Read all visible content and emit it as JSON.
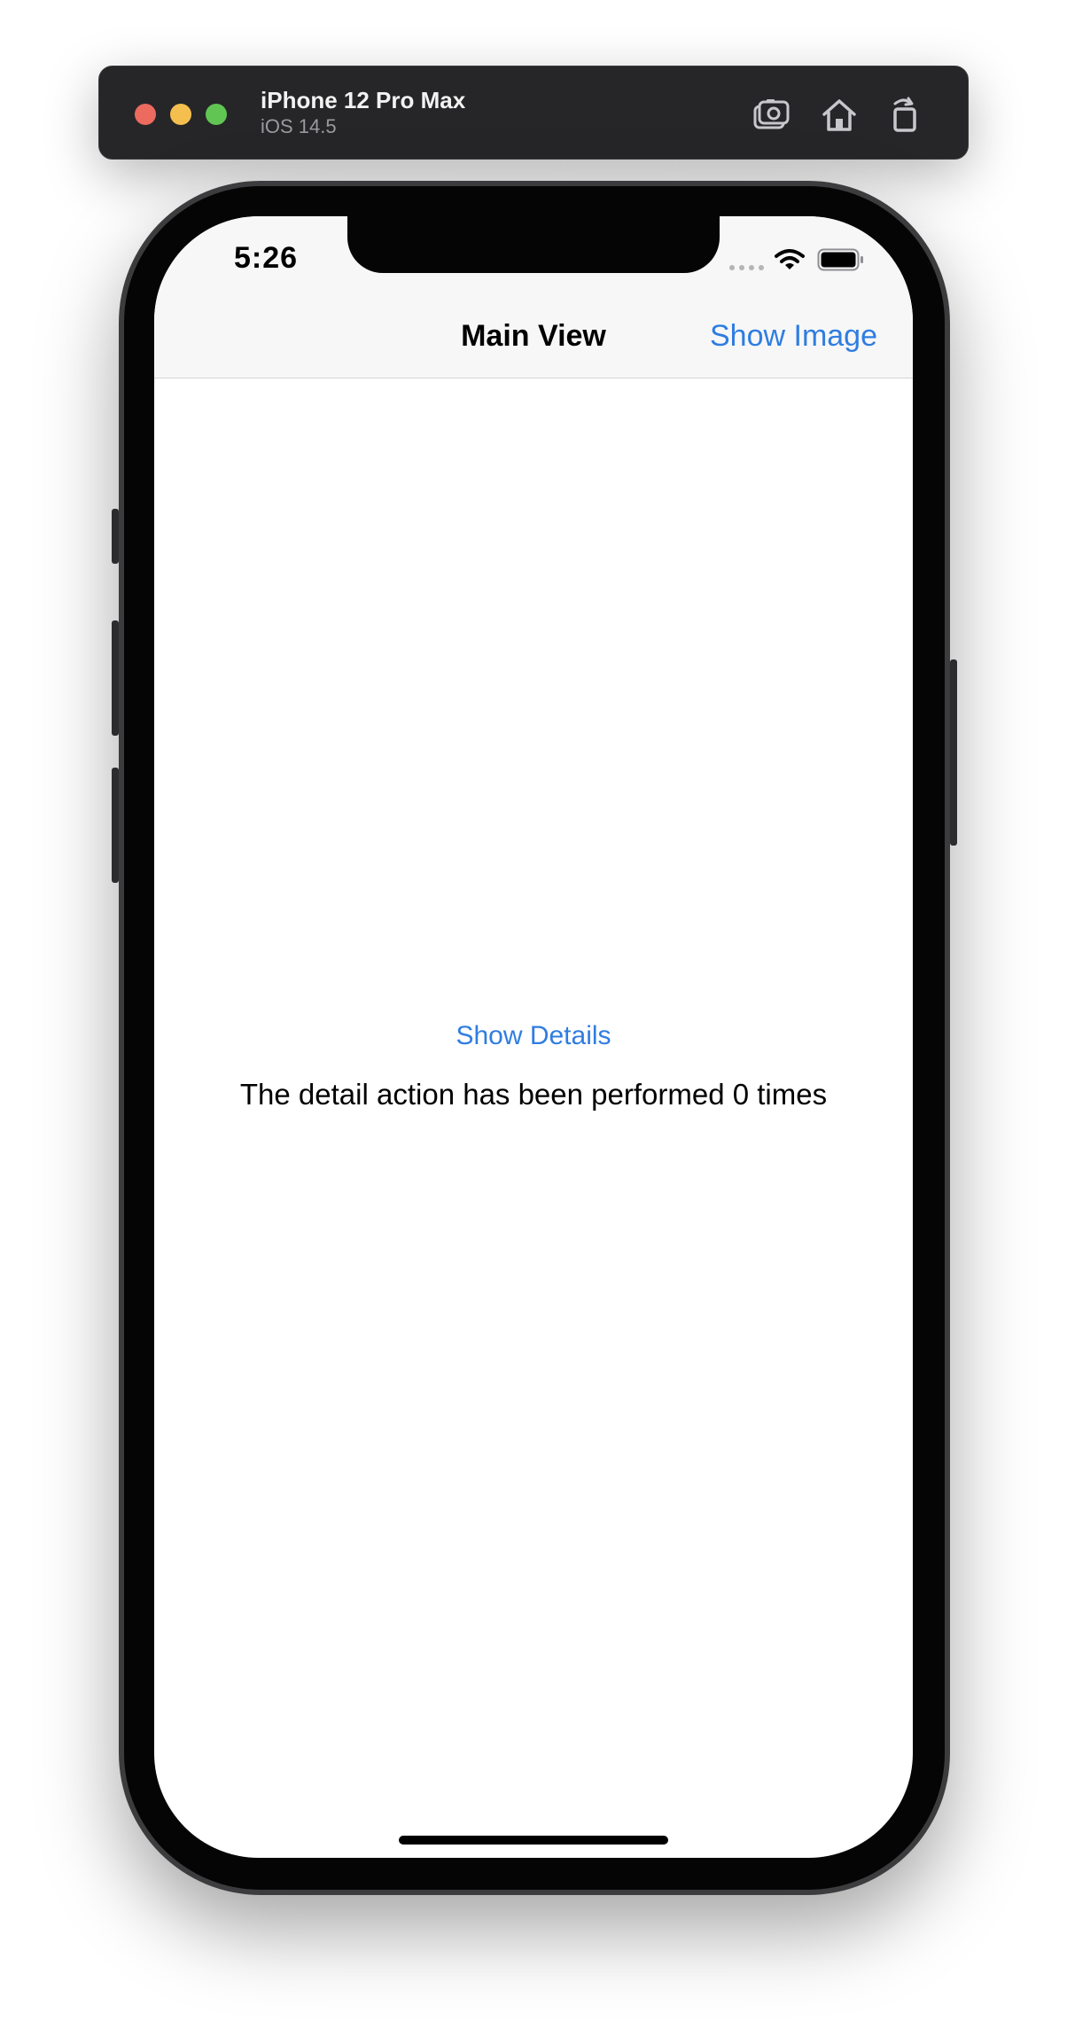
{
  "simulator": {
    "device_name": "iPhone 12 Pro Max",
    "os_version": "iOS 14.5",
    "toolbar_icons": [
      "screenshot-icon",
      "home-icon",
      "rotate-icon"
    ]
  },
  "status_bar": {
    "time": "5:26",
    "icons": [
      "cellular-signal-icon",
      "wifi-icon",
      "battery-icon"
    ]
  },
  "nav_bar": {
    "title": "Main View",
    "right_button": "Show Image"
  },
  "content": {
    "button_label": "Show Details",
    "message": "The detail action has been performed 0 times"
  },
  "colors": {
    "accent": "#2f7de1",
    "nav_background": "#f7f7f7",
    "simulator_bar": "#262628"
  }
}
